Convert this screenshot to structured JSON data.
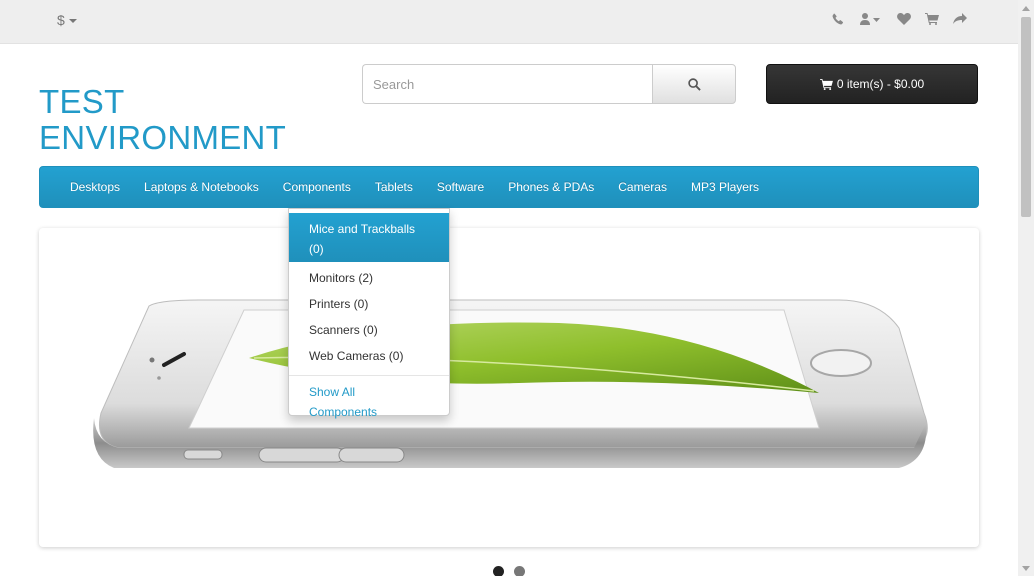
{
  "topbar": {
    "currency_symbol": "$",
    "icons": [
      "phone-icon",
      "user-icon",
      "heart-icon",
      "cart-icon",
      "share-icon"
    ]
  },
  "header": {
    "logo_line1": "TEST",
    "logo_line2": "ENVIRONMENT",
    "search_placeholder": "Search",
    "cart_label": "0 item(s) - $0.00"
  },
  "menu": {
    "items": [
      "Desktops",
      "Laptops & Notebooks",
      "Components",
      "Tablets",
      "Software",
      "Phones & PDAs",
      "Cameras",
      "MP3 Players"
    ]
  },
  "dropdown": {
    "items": [
      "Mice and Trackballs (0)",
      "Monitors (2)",
      "Printers (0)",
      "Scanners (0)",
      "Web Cameras (0)"
    ],
    "active_line1": "Mice and Trackballs",
    "active_line2": "(0)",
    "show_all_line1": "Show All",
    "show_all_line2": "Components"
  },
  "slideshow": {
    "current_index": 0,
    "total": 2
  },
  "colors": {
    "accent": "#229ac8",
    "menu_bg": "#229ac8",
    "cart_bg": "#222222"
  }
}
